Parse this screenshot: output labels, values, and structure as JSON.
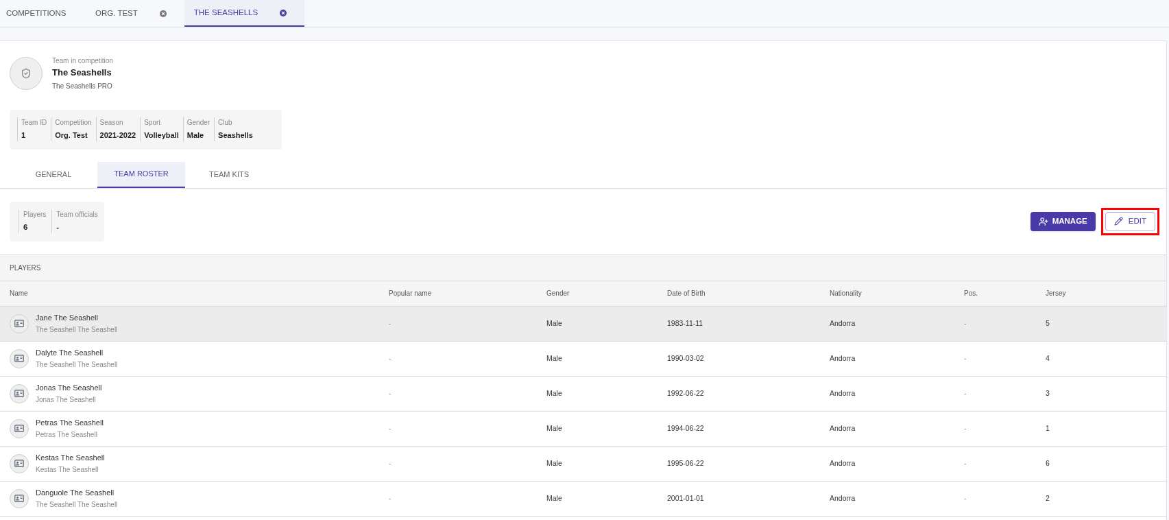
{
  "top_tabs": [
    {
      "label": "COMPETITIONS",
      "closable": false,
      "selected": false
    },
    {
      "label": "ORG. TEST",
      "closable": true,
      "selected": false
    },
    {
      "label": "THE SEASHELLS",
      "closable": true,
      "selected": true
    }
  ],
  "header": {
    "caption": "Team in competition",
    "title": "The Seashells",
    "subtitle": "The Seashells PRO"
  },
  "info": [
    {
      "label": "Team ID",
      "value": "1"
    },
    {
      "label": "Competition",
      "value": "Org. Test"
    },
    {
      "label": "Season",
      "value": "2021-2022"
    },
    {
      "label": "Sport",
      "value": "Volleyball"
    },
    {
      "label": "Gender",
      "value": "Male"
    },
    {
      "label": "Club",
      "value": "Seashells"
    }
  ],
  "section_tabs": [
    {
      "label": "GENERAL",
      "selected": false
    },
    {
      "label": "TEAM ROSTER",
      "selected": true
    },
    {
      "label": "TEAM KITS",
      "selected": false
    }
  ],
  "stats": [
    {
      "label": "Players",
      "value": "6"
    },
    {
      "label": "Team officials",
      "value": "-"
    }
  ],
  "actions": {
    "manage": "MANAGE",
    "edit": "EDIT",
    "edit_highlighted": true
  },
  "table": {
    "title": "PLAYERS",
    "columns": [
      "Name",
      "Popular name",
      "Gender",
      "Date of Birth",
      "Nationality",
      "Pos.",
      "Jersey"
    ],
    "rows": [
      {
        "name": "Jane The Seashell",
        "sub": "The Seashell The Seashell",
        "popular": "-",
        "gender": "Male",
        "dob": "1983-11-11",
        "nationality": "Andorra",
        "pos": "-",
        "jersey": "5",
        "selected": true
      },
      {
        "name": "Dalyte The Seashell",
        "sub": "The Seashell The Seashell",
        "popular": "-",
        "gender": "Male",
        "dob": "1990-03-02",
        "nationality": "Andorra",
        "pos": "-",
        "jersey": "4",
        "selected": false
      },
      {
        "name": "Jonas The Seashell",
        "sub": "Jonas The Seashell",
        "popular": "-",
        "gender": "Male",
        "dob": "1992-06-22",
        "nationality": "Andorra",
        "pos": "-",
        "jersey": "3",
        "selected": false
      },
      {
        "name": "Petras The Seashell",
        "sub": "Petras The Seashell",
        "popular": "-",
        "gender": "Male",
        "dob": "1994-06-22",
        "nationality": "Andorra",
        "pos": "-",
        "jersey": "1",
        "selected": false
      },
      {
        "name": "Kestas The Seashell",
        "sub": "Kestas The Seashell",
        "popular": "-",
        "gender": "Male",
        "dob": "1995-06-22",
        "nationality": "Andorra",
        "pos": "-",
        "jersey": "6",
        "selected": false
      },
      {
        "name": "Danguole The Seashell",
        "sub": "The Seashell The Seashell",
        "popular": "-",
        "gender": "Male",
        "dob": "2001-01-01",
        "nationality": "Andorra",
        "pos": "-",
        "jersey": "2",
        "selected": false
      }
    ]
  }
}
